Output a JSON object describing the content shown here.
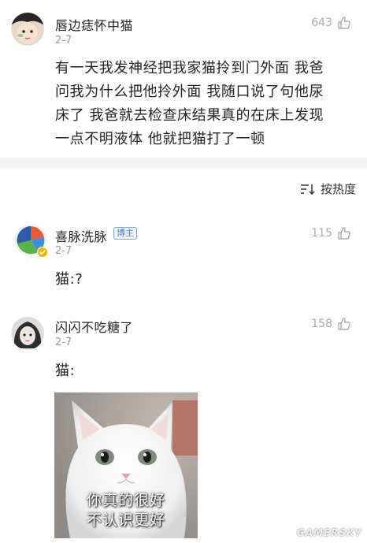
{
  "post": {
    "username": "唇边痣怀中猫",
    "date": "2-7",
    "likes": "643",
    "lines": [
      "有一天我发神经把我家猫拎到门外面 我爸",
      "问我为什么把他拎外面 我随口说了句他尿",
      "床了 我爸就去检查床结果真的在床上发现",
      "一点不明液体 他就把猫打了一顿"
    ]
  },
  "sort": {
    "label": "按热度",
    "icon": "sort-lines-icon"
  },
  "comments": [
    {
      "username": "喜脉洗脉",
      "badge": "博主",
      "date": "2-7",
      "likes": "115",
      "text": "猫:?"
    },
    {
      "username": "闪闪不吃糖了",
      "date": "2-7",
      "likes": "158",
      "text": "猫:",
      "meme_caption": [
        "你真的很好",
        "不认识更好"
      ]
    }
  ],
  "watermark": "GAMERSKY",
  "colors": {
    "divider": "#f2f2f2",
    "badge": "#4a7fc1",
    "meta": "#999999"
  }
}
